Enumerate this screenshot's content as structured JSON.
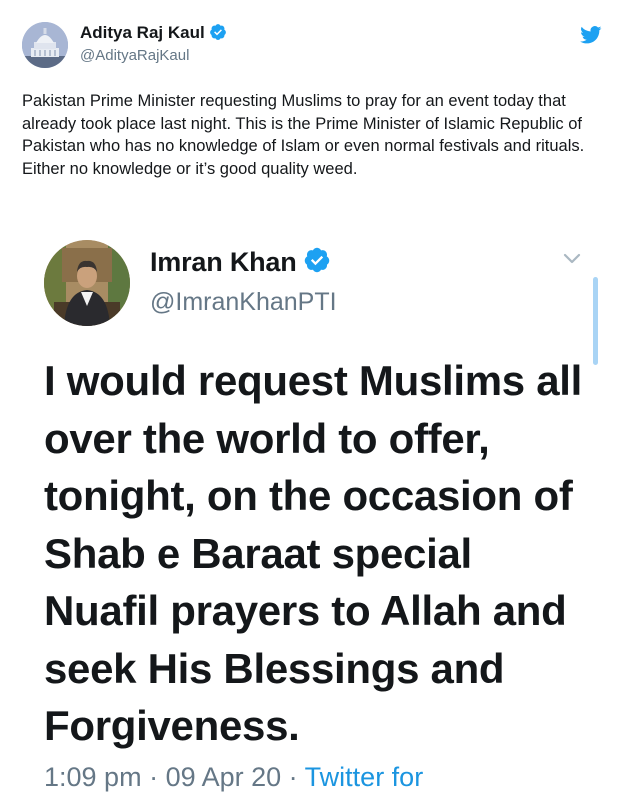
{
  "author": {
    "name": "Aditya Raj Kaul",
    "handle": "@AdityaRajKaul"
  },
  "tweet": {
    "text": "Pakistan Prime Minister requesting Muslims to pray for an event today that already took place last night. This is the Prime Minister of Islamic Republic of Pakistan who has no knowledge of Islam or even normal festivals and rituals. Either no knowledge or it’s good quality weed."
  },
  "embedded": {
    "name": "Imran Khan",
    "handle": "@ImranKhanPTI",
    "text": "I would request Muslims all over the world to offer, tonight, on the occasion of Shab e Baraat special Nuafil prayers to Allah and seek His Blessings and Forgiveness.",
    "time": "1:09 pm",
    "separator": " · ",
    "date": "09 Apr 20",
    "source": "Twitter for"
  },
  "icons": {
    "verified": "verified-badge-icon",
    "twitter": "twitter-bird-icon",
    "chevron": "chevron-down-icon"
  },
  "colors": {
    "twitter_blue": "#1da1f2",
    "link_blue": "#1b95e0",
    "secondary_text": "#657786",
    "primary_text": "#14171a"
  }
}
